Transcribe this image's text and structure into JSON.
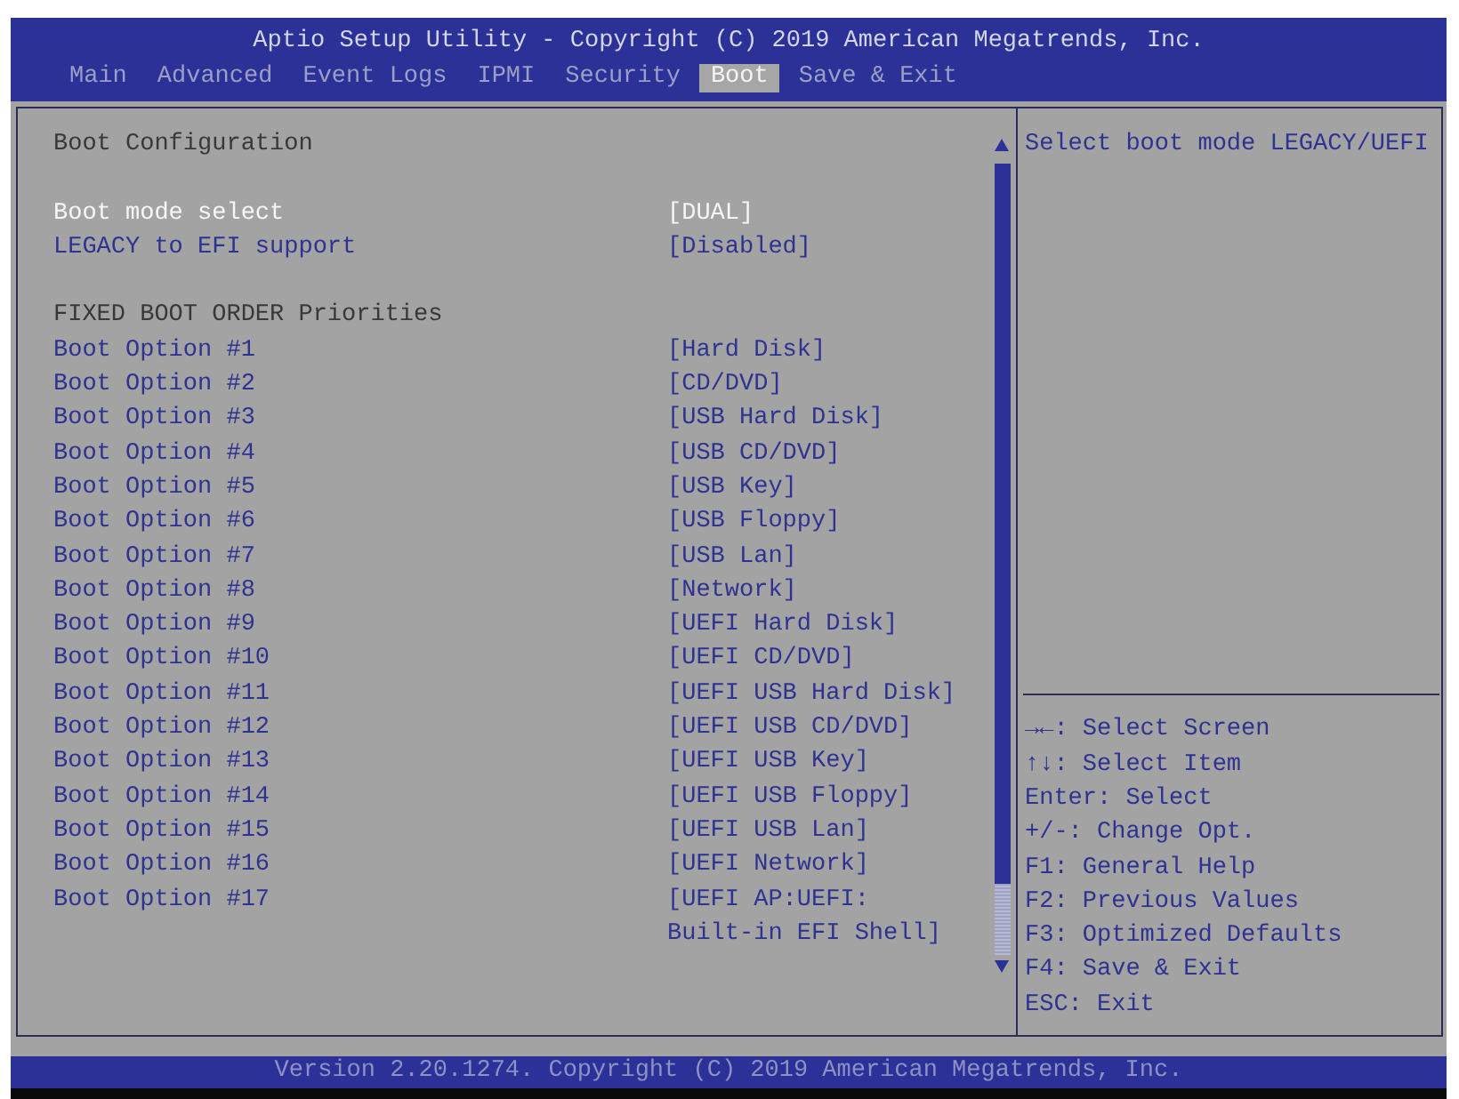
{
  "window": {
    "title": "Aptio Setup Utility - Copyright (C) 2019 American Megatrends, Inc."
  },
  "tabs": [
    {
      "label": "Main",
      "selected": false
    },
    {
      "label": "Advanced",
      "selected": false
    },
    {
      "label": "Event Logs",
      "selected": false
    },
    {
      "label": "IPMI",
      "selected": false
    },
    {
      "label": "Security",
      "selected": false
    },
    {
      "label": "Boot",
      "selected": true
    },
    {
      "label": "Save & Exit",
      "selected": false
    }
  ],
  "settings": {
    "sections": [
      {
        "heading": "Boot Configuration",
        "items": [
          {
            "label": "Boot mode select",
            "value": "[DUAL]",
            "selected": true
          },
          {
            "label": "LEGACY to EFI support",
            "value": "[Disabled]",
            "selected": false
          }
        ]
      },
      {
        "heading": "FIXED BOOT ORDER Priorities",
        "items": [
          {
            "label": "Boot Option #1",
            "value": "[Hard Disk]",
            "selected": false
          },
          {
            "label": "Boot Option #2",
            "value": "[CD/DVD]",
            "selected": false
          },
          {
            "label": "Boot Option #3",
            "value": "[USB Hard Disk]",
            "selected": false
          },
          {
            "label": "Boot Option #4",
            "value": "[USB CD/DVD]",
            "selected": false
          },
          {
            "label": "Boot Option #5",
            "value": "[USB Key]",
            "selected": false
          },
          {
            "label": "Boot Option #6",
            "value": "[USB Floppy]",
            "selected": false
          },
          {
            "label": "Boot Option #7",
            "value": "[USB Lan]",
            "selected": false
          },
          {
            "label": "Boot Option #8",
            "value": "[Network]",
            "selected": false
          },
          {
            "label": "Boot Option #9",
            "value": "[UEFI Hard Disk]",
            "selected": false
          },
          {
            "label": "Boot Option #10",
            "value": "[UEFI CD/DVD]",
            "selected": false
          },
          {
            "label": "Boot Option #11",
            "value": "[UEFI USB Hard Disk]",
            "selected": false
          },
          {
            "label": "Boot Option #12",
            "value": "[UEFI USB CD/DVD]",
            "selected": false
          },
          {
            "label": "Boot Option #13",
            "value": "[UEFI USB Key]",
            "selected": false
          },
          {
            "label": "Boot Option #14",
            "value": "[UEFI USB Floppy]",
            "selected": false
          },
          {
            "label": "Boot Option #15",
            "value": "[UEFI USB Lan]",
            "selected": false
          },
          {
            "label": "Boot Option #16",
            "value": "[UEFI Network]",
            "selected": false
          },
          {
            "label": "Boot Option #17",
            "value": "[UEFI AP:UEFI: Built-in EFI Shell]",
            "selected": false
          }
        ]
      }
    ]
  },
  "help_panel": {
    "description": "Select boot mode LEGACY/UEFI",
    "key_hints": [
      "→←: Select Screen",
      "↑↓: Select Item",
      "Enter: Select",
      "+/-: Change Opt.",
      "F1: General Help",
      "F2: Previous Values",
      "F3: Optimized Defaults",
      "F4: Save & Exit",
      "ESC: Exit"
    ]
  },
  "status_bar": {
    "text": "Version 2.20.1274. Copyright (C) 2019 American Megatrends, Inc."
  }
}
